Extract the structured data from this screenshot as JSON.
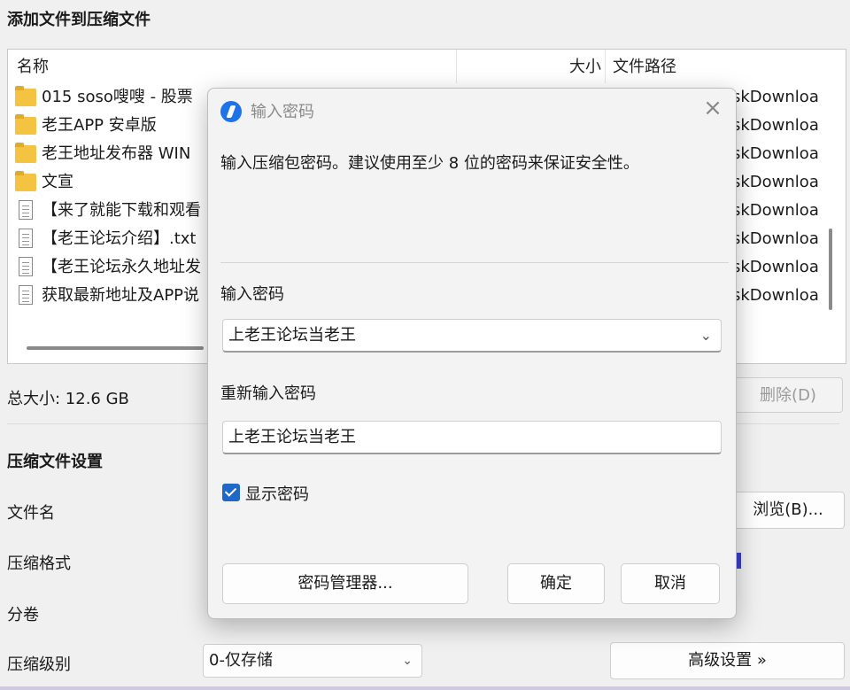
{
  "window": {
    "title": "添加文件到压缩文件"
  },
  "file_list": {
    "columns": {
      "name": "名称",
      "size": "大小",
      "path": "文件路径"
    },
    "rows": [
      {
        "type": "folder",
        "name": "015 soso嗖嗖 - 股票",
        "path": "skDownloa"
      },
      {
        "type": "folder",
        "name": "老王APP 安卓版",
        "path": "skDownloa"
      },
      {
        "type": "folder",
        "name": "老王地址发布器 WIN",
        "path": "skDownloa"
      },
      {
        "type": "folder",
        "name": "文宣",
        "path": "skDownloa"
      },
      {
        "type": "file",
        "name": "【来了就能下载和观看",
        "path": "skDownloa"
      },
      {
        "type": "file",
        "name": "【老王论坛介绍】.txt",
        "path": "skDownloa"
      },
      {
        "type": "file",
        "name": "【老王论坛永久地址发",
        "path": "skDownloa"
      },
      {
        "type": "file",
        "name": "获取最新地址及APP说",
        "path": "skDownloa"
      }
    ]
  },
  "total_size": "总大小: 12.6 GB",
  "delete_button": "删除(D)",
  "settings": {
    "heading": "压缩文件设置",
    "filename_label": "文件名",
    "browse_button": "浏览(B)...",
    "format_label": "压缩格式",
    "volume_label": "分卷",
    "level_label": "压缩级别",
    "level_value": "0-仅存储",
    "advanced_button": "高级设置 »"
  },
  "dialog": {
    "title": "输入密码",
    "message": "输入压缩包密码。建议使用至少 8 位的密码来保证安全性。",
    "password_label": "输入密码",
    "password_value": "上老王论坛当老王",
    "confirm_label": "重新输入密码",
    "confirm_value": "上老王论坛当老王",
    "show_password_label": "显示密码",
    "show_password_checked": true,
    "manager_button": "密码管理器...",
    "ok_button": "确定",
    "cancel_button": "取消"
  },
  "colors": {
    "accent": "#1f67c8",
    "folder": "#f5c342"
  }
}
